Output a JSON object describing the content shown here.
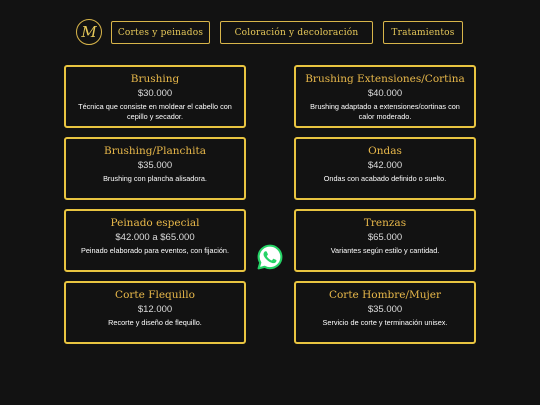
{
  "logo": {
    "letter": "M"
  },
  "nav": [
    {
      "label": "Cortes y peinados"
    },
    {
      "label": "Coloración y decoloración"
    },
    {
      "label": "Tratamientos"
    }
  ],
  "services": [
    {
      "title": "Brushing",
      "price": "$30.000",
      "desc": "Técnica que consiste en moldear el cabello con cepillo y secador."
    },
    {
      "title": "Brushing Extensiones/Cortina",
      "price": "$40.000",
      "desc": "Brushing adaptado a extensiones/cortinas con calor moderado."
    },
    {
      "title": "Brushing/Planchita",
      "price": "$35.000",
      "desc": "Brushing con plancha alisadora."
    },
    {
      "title": "Ondas",
      "price": "$42.000",
      "desc": "Ondas con acabado definido o suelto."
    },
    {
      "title": "Peinado especial",
      "price": "$42.000 a $65.000",
      "desc": "Peinado elaborado para eventos, con fijación."
    },
    {
      "title": "Trenzas",
      "price": "$65.000",
      "desc": "Variantes según estilo y cantidad."
    },
    {
      "title": "Corte Flequillo",
      "price": "$12.000",
      "desc": "Recorte y diseño de flequillo."
    },
    {
      "title": "Corte Hombre/Mujer",
      "price": "$35.000",
      "desc": "Servicio de corte y terminación unisex."
    }
  ],
  "colors": {
    "accent": "#e8c440",
    "title": "#e8b84a",
    "background": "#121212",
    "whatsapp": "#25d366"
  },
  "icons": {
    "floating": "whatsapp-icon"
  }
}
